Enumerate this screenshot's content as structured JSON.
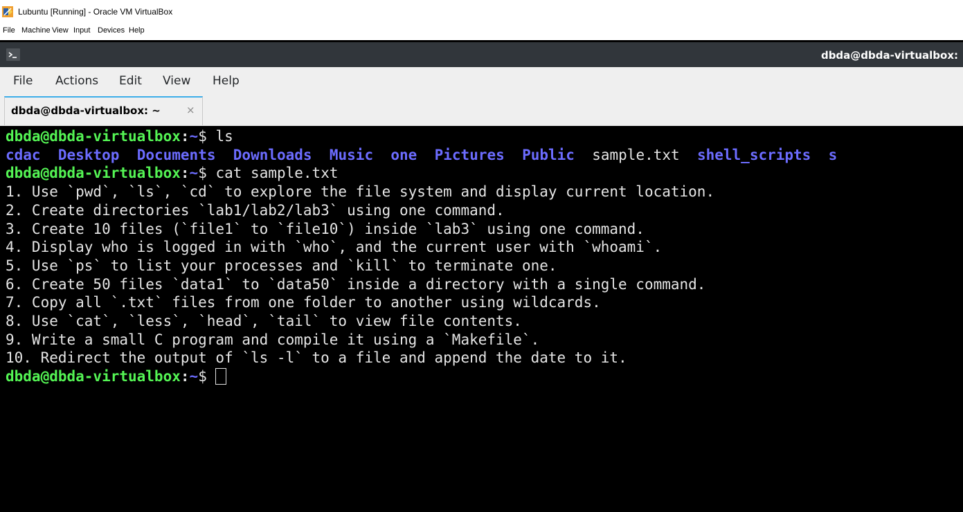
{
  "vbox": {
    "title": "Lubuntu [Running] - Oracle VM VirtualBox",
    "menu": [
      "File",
      "Machine",
      "View",
      "Input",
      "Devices",
      "Help"
    ]
  },
  "panel": {
    "icon": "terminal-icon",
    "title": "dbda@dbda-virtualbox:"
  },
  "terminal_app": {
    "menu": [
      "File",
      "Actions",
      "Edit",
      "View",
      "Help"
    ],
    "tab": {
      "label": "dbda@dbda-virtualbox: ~",
      "close": "×"
    }
  },
  "terminal": {
    "prompt": {
      "user_host": "dbda@dbda-virtualbox",
      "colon": ":",
      "path": "~",
      "symbol": "$ "
    },
    "commands": [
      "ls",
      "cat sample.txt"
    ],
    "ls_output": [
      {
        "name": "cdac",
        "type": "dir"
      },
      {
        "name": "Desktop",
        "type": "dir"
      },
      {
        "name": "Documents",
        "type": "dir"
      },
      {
        "name": "Downloads",
        "type": "dir"
      },
      {
        "name": "Music",
        "type": "dir"
      },
      {
        "name": "one",
        "type": "dir"
      },
      {
        "name": "Pictures",
        "type": "dir"
      },
      {
        "name": "Public",
        "type": "dir"
      },
      {
        "name": "sample.txt",
        "type": "file"
      },
      {
        "name": "shell_scripts",
        "type": "dir"
      },
      {
        "name": "s",
        "type": "dir"
      }
    ],
    "file_lines": [
      "1. Use `pwd`, `ls`, `cd` to explore the file system and display current location.",
      "2. Create directories `lab1/lab2/lab3` using one command.",
      "3. Create 10 files (`file1` to `file10`) inside `lab3` using one command.",
      "4. Display who is logged in with `who`, and the current user with `whoami`.",
      "5. Use `ps` to list your processes and `kill` to terminate one.",
      "6. Create 50 files `data1` to `data50` inside a directory with a single command.",
      "7. Copy all `.txt` files from one folder to another using wildcards.",
      "8. Use `cat`, `less`, `head`, `tail` to view file contents.",
      "9. Write a small C program and compile it using a `Makefile`.",
      "10. Redirect the output of `ls -l` to a file and append the date to it."
    ]
  },
  "colors": {
    "prompt_user": "#54f454",
    "directory": "#6c6cff",
    "text": "#e5e5e5",
    "background": "#000000",
    "panel": "#31363b"
  }
}
